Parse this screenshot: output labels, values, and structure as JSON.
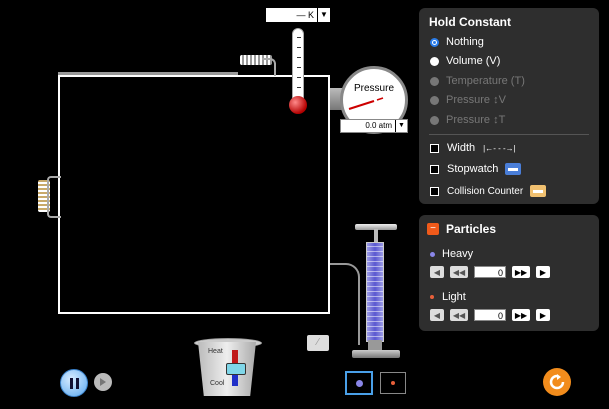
{
  "thermometer": {
    "unit_value": "— K",
    "dropdown": "▼"
  },
  "gauge": {
    "title": "Pressure",
    "readout": "0.0 atm",
    "dropdown": "▼"
  },
  "hold_constant": {
    "title": "Hold Constant",
    "options": [
      {
        "label": "Nothing",
        "state": "selected"
      },
      {
        "label": "Volume (V)",
        "state": "enabled"
      },
      {
        "label": "Temperature (T)",
        "state": "disabled"
      },
      {
        "label": "Pressure ↕V",
        "state": "disabled"
      },
      {
        "label": "Pressure ↕T",
        "state": "disabled"
      }
    ],
    "checkboxes": [
      {
        "label": "Width",
        "extra": "|←- - -→|"
      },
      {
        "label": "Stopwatch"
      },
      {
        "label": "Collision Counter"
      }
    ]
  },
  "particles": {
    "title": "Particles",
    "toggle": "−",
    "heavy": {
      "label": "Heavy",
      "value": "0"
    },
    "light": {
      "label": "Light",
      "value": "0"
    },
    "colors": {
      "heavy": "#8a86e8",
      "light": "#e8603a"
    }
  },
  "bucket": {
    "heat": "Heat",
    "cool": "Cool"
  },
  "colors": {
    "accent": "#2b7de9",
    "reset": "#f28c1c"
  }
}
